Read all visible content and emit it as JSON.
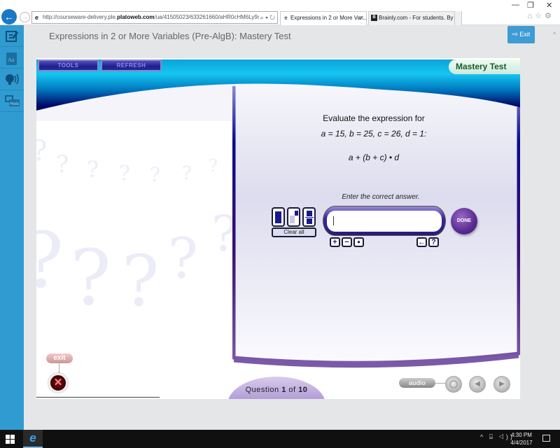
{
  "browser": {
    "url_prefix": "http://courseware-delivery.ple.",
    "url_host": "platoweb.com",
    "url_suffix": "/ua/41505023/633261660/aHR0cHM6Ly9sZWFj",
    "address_icons": "⌕ ▾ ↻",
    "tabs": [
      {
        "label": "Expressions in 2 or More Var...",
        "active": true,
        "icon": "ie-e"
      },
      {
        "label": "Brainly.com - For students. By ...",
        "active": false,
        "icon": "brainly"
      }
    ],
    "tab_close": "✕",
    "window_controls": {
      "minimize": "—",
      "restore": "❐",
      "close": "✕"
    },
    "toolbar_icons": "⌂☆⚙"
  },
  "page": {
    "title": "Expressions in 2 or More Variables (Pre-AlgB): Mastery Test",
    "exit_label": "Exit",
    "exit_icon": "⇨"
  },
  "rail": {
    "items": [
      {
        "name": "notes",
        "icon": "edit-icon"
      },
      {
        "name": "dictionary",
        "icon": "dictionary-icon"
      },
      {
        "name": "text-to-speech",
        "icon": "speaker-icon"
      },
      {
        "name": "translate",
        "icon": "translate-icon",
        "text": "Hola"
      }
    ]
  },
  "app": {
    "tools_label": "TOOLS",
    "refresh_label": "REFRESH",
    "mode_label": "Mastery Test",
    "question": {
      "line1": "Evaluate the expression for",
      "line2": "a = 15, b = 25, c = 26, d = 1:",
      "expression": "a + (b + c) • d"
    },
    "instruction": "Enter the correct answer.",
    "answer_value": "",
    "clear_all_label": "Clear all",
    "done_label": "DONE",
    "symbol_buttons": [
      {
        "name": "plus",
        "glyph": "+"
      },
      {
        "name": "minus",
        "glyph": "−"
      },
      {
        "name": "dot",
        "glyph": "●"
      },
      {
        "name": "backspace",
        "glyph": "←"
      },
      {
        "name": "help",
        "glyph": "?"
      }
    ],
    "exit_label": "exit",
    "exit_x": "✕",
    "question_counter": {
      "prefix": "Question",
      "current": "1",
      "of": "of",
      "total": "10"
    },
    "audio_label": "audio",
    "nav": {
      "prev": "◀",
      "next": "▶"
    }
  },
  "taskbar": {
    "time": "4:30 PM",
    "date": "4/4/2017",
    "tray_icons": "^ ⌸ ◁))"
  }
}
